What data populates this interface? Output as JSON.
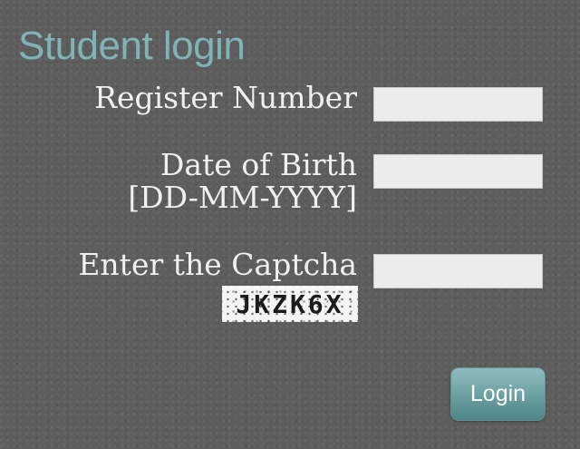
{
  "form": {
    "title": "Student login",
    "register_label": "Register Number",
    "register_value": "",
    "dob_label_line1": "Date of Birth",
    "dob_label_line2": "[DD-MM-YYYY]",
    "dob_value": "",
    "captcha_label": "Enter the Captcha",
    "captcha_value": "",
    "captcha_text": "JKZK6X",
    "login_label": "Login"
  },
  "colors": {
    "background": "#5d5d5d",
    "title": "#7fb3b5",
    "label": "#f0f0f0",
    "input_bg": "#ececec",
    "button": "#6ea2a4"
  }
}
